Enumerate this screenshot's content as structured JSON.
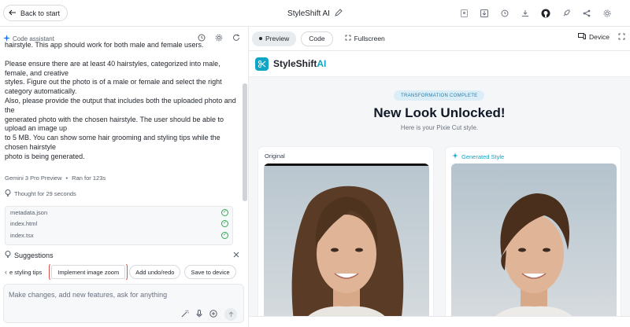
{
  "topbar": {
    "back_label": "Back to start",
    "app_title": "StyleShift AI",
    "icons": [
      "app-icon",
      "save-icon",
      "history-icon",
      "download-icon",
      "github-icon",
      "deploy-icon",
      "share-icon",
      "settings-icon"
    ]
  },
  "assistant": {
    "label": "Code assistant",
    "message": [
      "hairstyle. This app should work for both male and female users.",
      "",
      "Please ensure there are at least 40 hairstyles, categorized into male,",
      "female, and creative",
      "styles. Figure out the photo is of a male or female and select the right",
      "category automatically.",
      "Also, please provide the output that includes both the uploaded photo and",
      "the",
      "generated photo with the chosen hairstyle. The user should be able to",
      "upload an image up",
      "to 5 MB. You can show some hair grooming and styling tips while the",
      "chosen hairstyle",
      "photo is being generated."
    ],
    "model": "Gemini 3 Pro Preview",
    "separator": "•",
    "ran_for": "Ran for 123s",
    "thought": "Thought for 29 seconds",
    "files": [
      "metadata.json",
      "index.html",
      "index.tsx"
    ]
  },
  "suggestions": {
    "title": "Suggestions",
    "chips": [
      "e styling tips",
      "Implement image zoom",
      "Add undo/redo",
      "Save to device"
    ]
  },
  "composer": {
    "placeholder": "Make changes, add new features, ask for anything"
  },
  "preview": {
    "tabs": {
      "preview": "Preview",
      "code": "Code",
      "fullscreen": "Fullscreen"
    },
    "device": "Device",
    "brand_main": "StyleShift",
    "brand_accent": "AI",
    "badge": "TRANSFORMATION COMPLETE",
    "headline": "New Look Unlocked!",
    "subline": "Here is your Pixie Cut style.",
    "original_label": "Original",
    "generated_label": "Generated Style"
  },
  "colors": {
    "accent": "#0ea5c6",
    "highlight_outline": "#d9534f",
    "success": "#34a853"
  }
}
